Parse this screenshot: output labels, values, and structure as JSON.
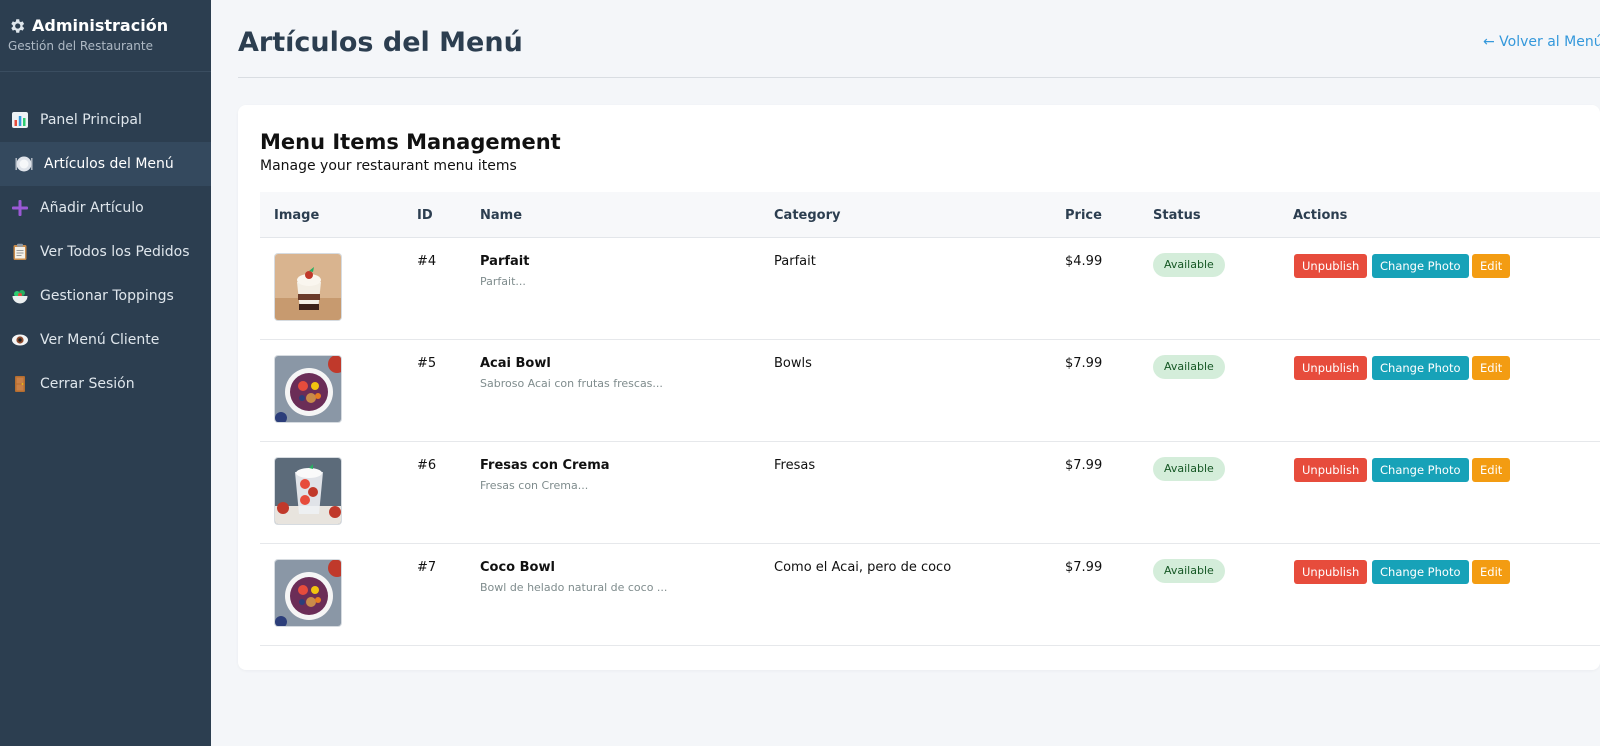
{
  "sidebar": {
    "title": "Administración",
    "subtitle": "Gestión del Restaurante",
    "items": [
      {
        "label": "Panel Principal",
        "icon": "bar-chart-icon"
      },
      {
        "label": "Artículos del Menú",
        "icon": "plate-icon"
      },
      {
        "label": "Añadir Artículo",
        "icon": "plus-icon"
      },
      {
        "label": "Ver Todos los Pedidos",
        "icon": "clipboard-icon"
      },
      {
        "label": "Gestionar Toppings",
        "icon": "salad-bowl-icon"
      },
      {
        "label": "Ver Menú Cliente",
        "icon": "eye-icon"
      },
      {
        "label": "Cerrar Sesión",
        "icon": "door-icon"
      }
    ]
  },
  "header": {
    "title": "Artículos del Menú",
    "back_link": "← Volver al Menú d"
  },
  "card": {
    "title": "Menu Items Management",
    "subtitle": "Manage your restaurant menu items"
  },
  "table": {
    "headers": {
      "image": "Image",
      "id": "ID",
      "name": "Name",
      "category": "Category",
      "price": "Price",
      "status": "Status",
      "actions": "Actions"
    },
    "rows": [
      {
        "id": "#4",
        "name": "Parfait",
        "desc": "Parfait...",
        "category": "Parfait",
        "price": "$4.99",
        "status": "Available",
        "image": "parfait-photo"
      },
      {
        "id": "#5",
        "name": "Acai Bowl",
        "desc": "Sabroso Acai con frutas frescas...",
        "category": "Bowls",
        "price": "$7.99",
        "status": "Available",
        "image": "acai-bowl-photo"
      },
      {
        "id": "#6",
        "name": "Fresas con Crema",
        "desc": "Fresas con Crema...",
        "category": "Fresas",
        "price": "$7.99",
        "status": "Available",
        "image": "strawberries-cream-photo"
      },
      {
        "id": "#7",
        "name": "Coco Bowl",
        "desc": "Bowl de helado natural de coco ...",
        "category": "Como el Acai, pero de coco",
        "price": "$7.99",
        "status": "Available",
        "image": "acai-bowl-photo"
      }
    ],
    "actions": {
      "unpublish": "Unpublish",
      "change_photo": "Change Photo",
      "edit": "Edit"
    }
  },
  "colors": {
    "sidebar_bg": "#2c3e50",
    "sidebar_active": "#34495e",
    "link": "#3498db",
    "unpublish": "#e74c3c",
    "change_photo": "#17a2b8",
    "edit": "#f39c12",
    "badge_bg": "#d4edda",
    "badge_text": "#155724"
  }
}
